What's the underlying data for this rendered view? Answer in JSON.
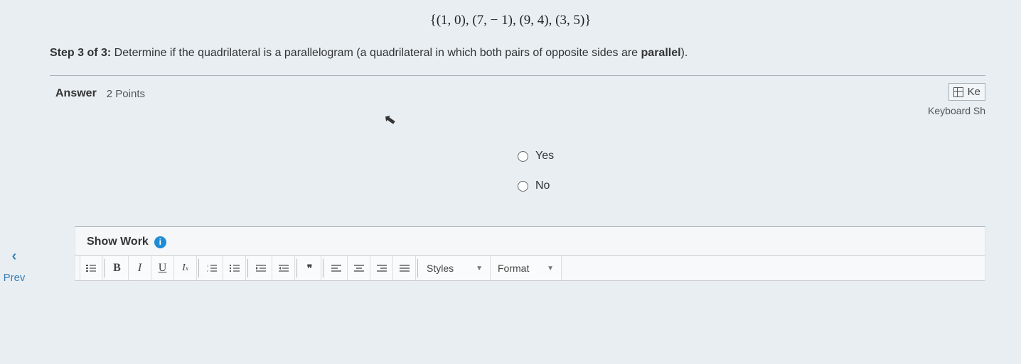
{
  "problem": {
    "points_set": "{(1, 0), (7, − 1), (9, 4), (3, 5)}",
    "step_label": "Step 3 of 3:",
    "instruction_prefix": " Determine if the quadrilateral is a parallelogram (a quadrilateral in which both pairs of opposite sides are ",
    "instruction_bold": "parallel",
    "instruction_suffix": ")."
  },
  "answer": {
    "label": "Answer",
    "points": "2 Points",
    "keypad_label": "Ke",
    "keyboard_shortcut_label": "Keyboard Sh",
    "options": [
      {
        "label": "Yes",
        "selected": false
      },
      {
        "label": "No",
        "selected": false
      }
    ]
  },
  "nav": {
    "prev_label": "Prev"
  },
  "show_work": {
    "label": "Show Work"
  },
  "toolbar": {
    "bold": "B",
    "italic": "I",
    "underline": "U",
    "clear": "Ix",
    "quote": "❝❝",
    "styles_label": "Styles",
    "format_label": "Format"
  }
}
